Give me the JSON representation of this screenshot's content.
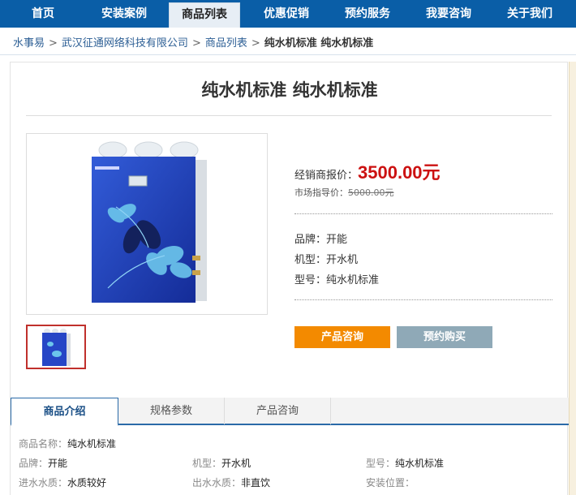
{
  "nav": {
    "items": [
      {
        "label": "首页"
      },
      {
        "label": "安装案例"
      },
      {
        "label": "商品列表"
      },
      {
        "label": "优惠促销"
      },
      {
        "label": "预约服务"
      },
      {
        "label": "我要咨询"
      },
      {
        "label": "关于我们"
      }
    ],
    "active_index": 2
  },
  "breadcrumb": {
    "items": [
      "水事易",
      "武汉征通网络科技有限公司",
      "商品列表"
    ],
    "current": "纯水机标准 纯水机标准",
    "separator": ">"
  },
  "product": {
    "title": "纯水机标准 纯水机标准",
    "price_label": "经销商报价：",
    "price_value": "3500.00元",
    "market_label": "市场指导价：",
    "market_value": "5000.00元",
    "specs": [
      {
        "label": "品牌：",
        "value": "开能"
      },
      {
        "label": "机型：",
        "value": "开水机"
      },
      {
        "label": "型号：",
        "value": "纯水机标准"
      }
    ],
    "consult_button": "产品咨询",
    "buy_button": "预约购买",
    "image": "water-purifier-image"
  },
  "tabs": {
    "items": [
      "商品介绍",
      "规格参数",
      "产品咨询"
    ],
    "active_index": 0
  },
  "info": {
    "name": {
      "label": "商品名称：",
      "value": "纯水机标准"
    },
    "brand": {
      "label": "品牌：",
      "value": "开能"
    },
    "type": {
      "label": "机型：",
      "value": "开水机"
    },
    "model": {
      "label": "型号：",
      "value": "纯水机标准"
    },
    "in_quality": {
      "label": "进水水质：",
      "value": "水质较好"
    },
    "out_quality": {
      "label": "出水水质：",
      "value": "非直饮"
    },
    "install": {
      "label": "安装位置：",
      "value": ""
    }
  },
  "colors": {
    "nav_bg": "#0a5ea7",
    "price": "#cc1111",
    "consult_button": "#f38a00",
    "buy_button": "#8fa9b7"
  }
}
